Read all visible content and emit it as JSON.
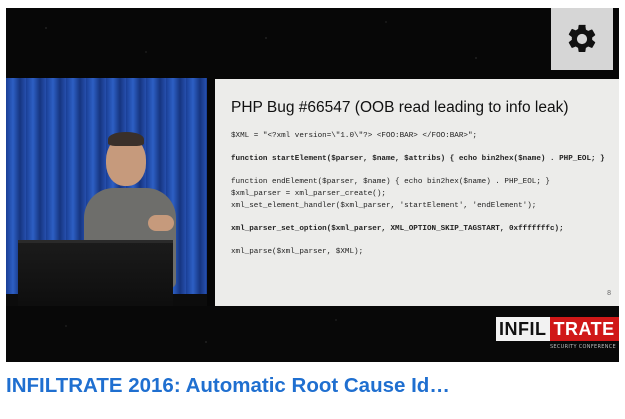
{
  "video": {
    "slide": {
      "title": "PHP Bug #66547 (OOB read leading to info leak)",
      "code_lines": [
        "$XML = \"<?xml version=\\\"1.0\\\"?> <FOO:BAR> </FOO:BAR>\";",
        "",
        "function startElement($parser, $name, $attribs) { echo bin2hex($name) . PHP_EOL; }",
        "",
        "function endElement($parser, $name) { echo bin2hex($name) . PHP_EOL; }",
        "$xml_parser = xml_parser_create();",
        "xml_set_element_handler($xml_parser, 'startElement', 'endElement');",
        "",
        "xml_parser_set_option($xml_parser, XML_OPTION_SKIP_TAGSTART, 0xfffffffc);",
        "",
        "xml_parse($xml_parser, $XML);"
      ],
      "page_number": "8"
    },
    "settings_icon": "gear-icon",
    "logo": {
      "part1": "INFIL",
      "part2": "TRATE",
      "subtitle": "SECURITY CONFERENCE"
    }
  },
  "caption": "INFILTRATE 2016: Automatic Root Cause Id…",
  "colors": {
    "caption": "#1f6fd0",
    "logo_red": "#d01818",
    "curtain_blue": "#2d5fc4"
  }
}
